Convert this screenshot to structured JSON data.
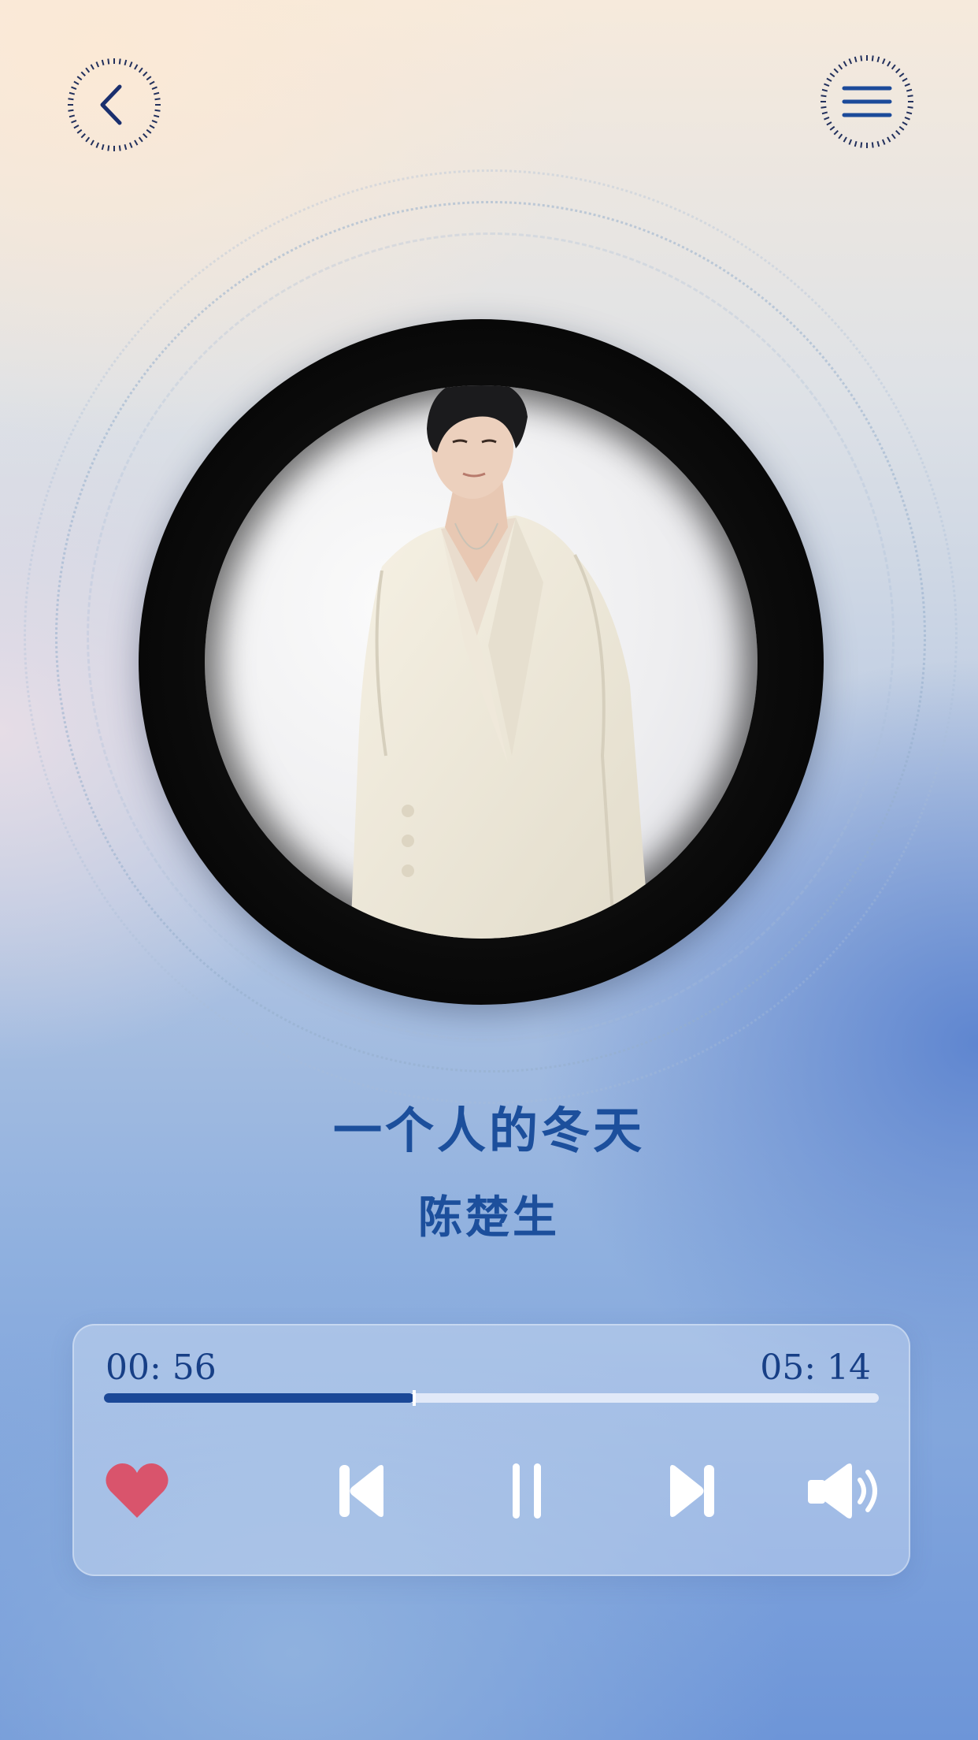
{
  "song": {
    "title": "一个人的冬天",
    "artist": "陈楚生"
  },
  "playback": {
    "elapsed": "00: 56",
    "total": "05: 14",
    "progress_fraction": 0.4,
    "state": "playing",
    "liked": true
  },
  "icons": {
    "back": "chevron-left-icon",
    "menu": "hamburger-menu-icon",
    "like": "heart-icon",
    "prev": "skip-previous-icon",
    "pause": "pause-icon",
    "next": "skip-next-icon",
    "volume": "volume-icon"
  },
  "colors": {
    "accent": "#1c4f9c",
    "progress_fill": "#1b4897",
    "heart": "#d9546c",
    "icon_light": "#ffffff"
  }
}
